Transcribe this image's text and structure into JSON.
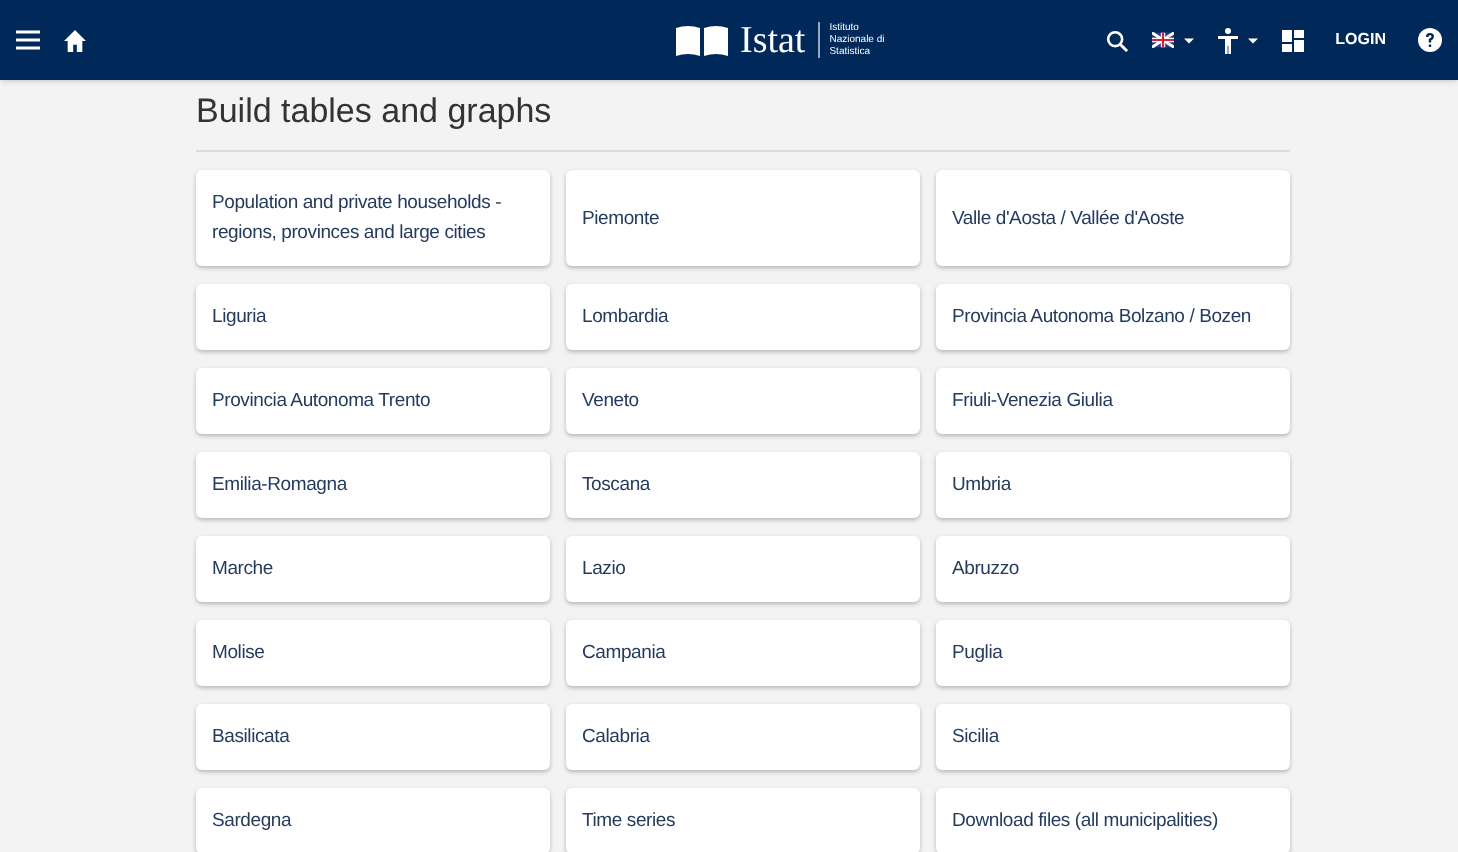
{
  "header": {
    "logo_text": "Istat",
    "logo_subtitle": "Istituto Nazionale di Statistica",
    "login": "LOGIN"
  },
  "title": "Build tables and graphs",
  "cards": [
    {
      "label": "Population and private households - regions, provinces and large cities"
    },
    {
      "label": "Piemonte"
    },
    {
      "label": "Valle d'Aosta / Vallée d'Aoste"
    },
    {
      "label": "Liguria"
    },
    {
      "label": "Lombardia"
    },
    {
      "label": "Provincia Autonoma Bolzano / Bozen"
    },
    {
      "label": "Provincia Autonoma Trento"
    },
    {
      "label": "Veneto"
    },
    {
      "label": "Friuli-Venezia Giulia"
    },
    {
      "label": "Emilia-Romagna"
    },
    {
      "label": "Toscana"
    },
    {
      "label": "Umbria"
    },
    {
      "label": "Marche"
    },
    {
      "label": "Lazio"
    },
    {
      "label": "Abruzzo"
    },
    {
      "label": "Molise"
    },
    {
      "label": "Campania"
    },
    {
      "label": "Puglia"
    },
    {
      "label": "Basilicata"
    },
    {
      "label": "Calabria"
    },
    {
      "label": "Sicilia"
    },
    {
      "label": "Sardegna"
    },
    {
      "label": "Time series"
    },
    {
      "label": "Download files (all municipalities)"
    }
  ]
}
